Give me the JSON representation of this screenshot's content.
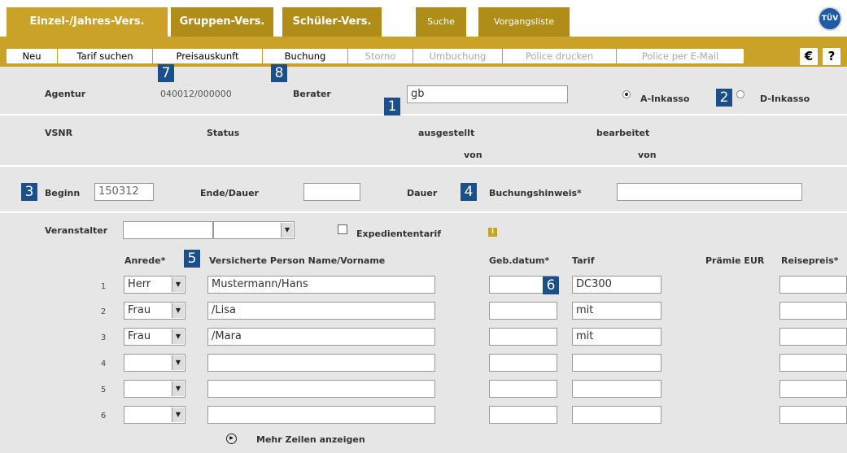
{
  "tabs": [
    {
      "label": "Einzel-/Jahres-Vers."
    },
    {
      "label": "Gruppen-Vers."
    },
    {
      "label": "Schüler-Vers."
    },
    {
      "label": "Suche"
    },
    {
      "label": "Vorgangsliste"
    }
  ],
  "logo": {
    "text": "TÜV"
  },
  "menu": [
    {
      "label": "Neu"
    },
    {
      "label": "Tarif suchen"
    },
    {
      "label": "Preisauskunft"
    },
    {
      "label": "Buchung"
    },
    {
      "label": "Storno"
    },
    {
      "label": "Umbuchung"
    },
    {
      "label": "Police drucken"
    },
    {
      "label": "Police per E-Mail"
    }
  ],
  "buttons": {
    "euro": "€",
    "help": "?"
  },
  "badges": {
    "b1": "1",
    "b2": "2",
    "b3": "3",
    "b4": "4",
    "b5": "5",
    "b6": "6",
    "b7": "7",
    "b8": "8"
  },
  "agency": {
    "label": "Agentur",
    "value": "040012/000000",
    "berater_label": "Berater",
    "berater_value": "gb"
  },
  "inkasso": {
    "a_label": "A-Inkasso",
    "d_label": "D-Inkasso",
    "selected": "A"
  },
  "contract": {
    "vsnr": "VSNR",
    "status": "Status",
    "ausgestellt": "ausgestellt",
    "bearbeitet": "bearbeitet",
    "von1": "von",
    "von2": "von"
  },
  "dates": {
    "beginn_label": "Beginn",
    "beginn_value": "150312",
    "ende_label": "Ende/Dauer",
    "dauer_label": "Dauer",
    "hinweis_label": "Buchungshinweis*"
  },
  "veranstalter": {
    "label": "Veranstalter",
    "expedient_label": "Expediententarif",
    "info": "i"
  },
  "table": {
    "headers": {
      "anrede": "Anrede*",
      "name": "Versicherte Person Name/Vorname",
      "geb": "Geb.datum*",
      "tarif": "Tarif",
      "praemie": "Prämie EUR",
      "reisepreis": "Reisepreis*"
    },
    "rows": [
      {
        "num": "1",
        "anrede": "Herr",
        "name": "Mustermann/Hans",
        "geb": "",
        "tarif": "DC300"
      },
      {
        "num": "2",
        "anrede": "Frau",
        "name": "/Lisa",
        "geb": "",
        "tarif": "mit"
      },
      {
        "num": "3",
        "anrede": "Frau",
        "name": "/Mara",
        "geb": "",
        "tarif": "mit"
      },
      {
        "num": "4",
        "anrede": "",
        "name": "",
        "geb": "",
        "tarif": ""
      },
      {
        "num": "5",
        "anrede": "",
        "name": "",
        "geb": "",
        "tarif": ""
      },
      {
        "num": "6",
        "anrede": "",
        "name": "",
        "geb": "",
        "tarif": ""
      }
    ]
  },
  "more": {
    "label": "Mehr Zeilen anzeigen"
  },
  "colors": {
    "gold": "#c9a227",
    "dark_gold": "#b08d18",
    "badge_blue": "#1b4f8a",
    "panel_gray": "#e6e6e6"
  }
}
